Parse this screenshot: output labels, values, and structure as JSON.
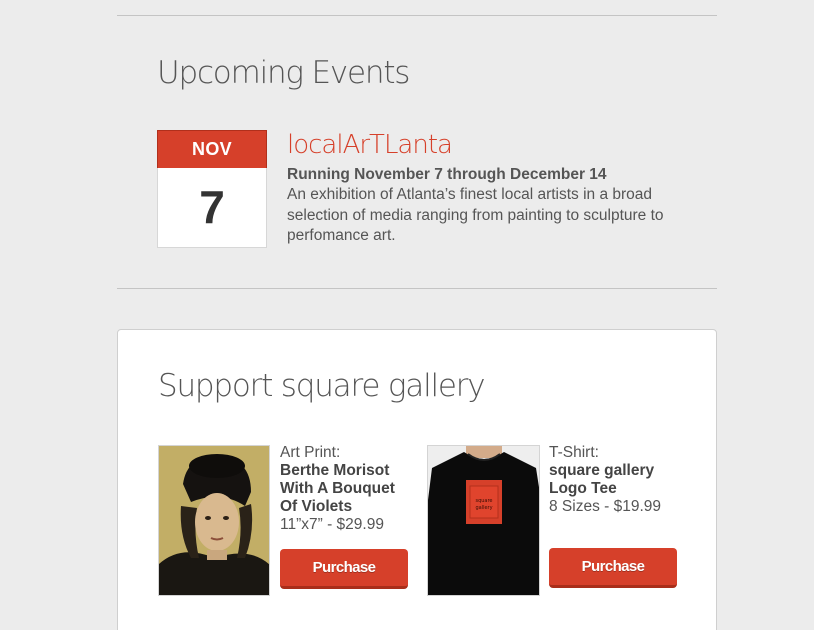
{
  "events": {
    "heading": "Upcoming Events",
    "items": [
      {
        "month": "NOV",
        "day": "7",
        "title": "localArTLanta",
        "running": "Running November 7 through December 14",
        "description": "An exhibition of Atlanta’s finest local artists in a broad selection of media ranging from painting to sculpture to perfomance art."
      }
    ]
  },
  "support": {
    "heading": "Support square gallery",
    "products": [
      {
        "type": "Art Print:",
        "name": "Berthe Morisot With A Bouquet Of Violets",
        "details": "11”x7” - $29.99",
        "button": "Purchase"
      },
      {
        "type": "T-Shirt:",
        "name": "square gallery Logo Tee",
        "details": "8 Sizes - $19.99",
        "button": "Purchase",
        "logo_text": "square gallery"
      }
    ]
  },
  "colors": {
    "accent": "#d6402a",
    "background": "#ececec",
    "card": "#ffffff"
  }
}
